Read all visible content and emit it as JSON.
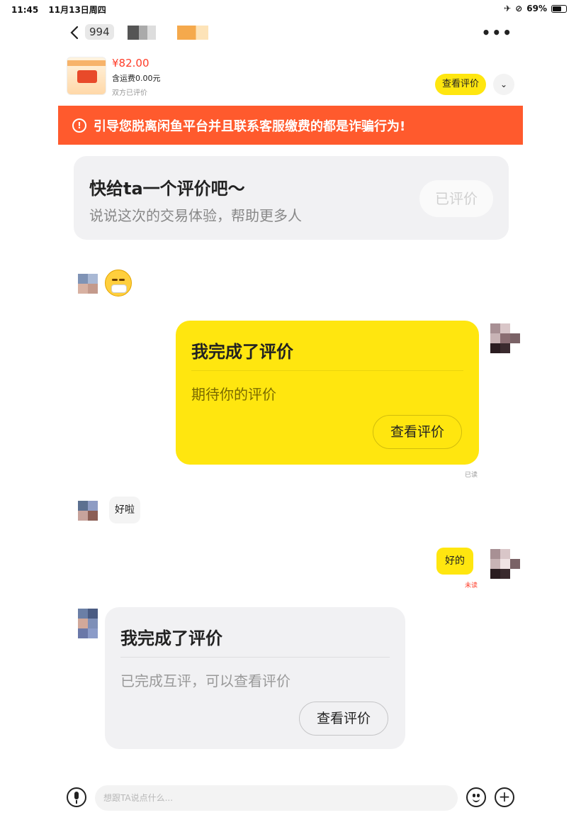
{
  "status_bar": {
    "time": "11:45",
    "date": "11月13日周四",
    "battery": "69%",
    "battery_level": 0.69
  },
  "header": {
    "title_fragment": "994",
    "more_icon": "more-dots-icon"
  },
  "product": {
    "price": "¥82.00",
    "shipping": "含运费0.00元",
    "review_status": "双方已评价",
    "view_review_label": "查看评价"
  },
  "warning": {
    "text": "引导您脱离闲鱼平台并且联系客服缴费的都是诈骗行为!"
  },
  "rate_card": {
    "title": "快给ta一个评价吧～",
    "subtitle": "说说这次的交易体验，帮助更多人",
    "button": "已评价"
  },
  "messages": [
    {
      "side": "left",
      "type": "emoji",
      "emoji": "sweat-smile-emoji"
    },
    {
      "side": "right",
      "type": "card",
      "title": "我完成了评价",
      "text": "期待你的评价",
      "button": "查看评价",
      "status": "已读"
    },
    {
      "side": "left",
      "type": "text",
      "text": "好啦"
    },
    {
      "side": "right",
      "type": "text",
      "text": "好的",
      "status": "未读"
    },
    {
      "side": "left",
      "type": "card",
      "title": "我完成了评价",
      "text": "已完成互评，可以查看评价",
      "button": "查看评价"
    }
  ],
  "input_bar": {
    "placeholder": "想跟TA说点什么...",
    "voice_icon": "microphone-icon",
    "emoji_icon": "smiley-icon",
    "plus_icon": "plus-icon"
  },
  "colors": {
    "accent_yellow": "#ffe60f",
    "warning_orange": "#ff5a2d",
    "price_red": "#ff3c28"
  }
}
